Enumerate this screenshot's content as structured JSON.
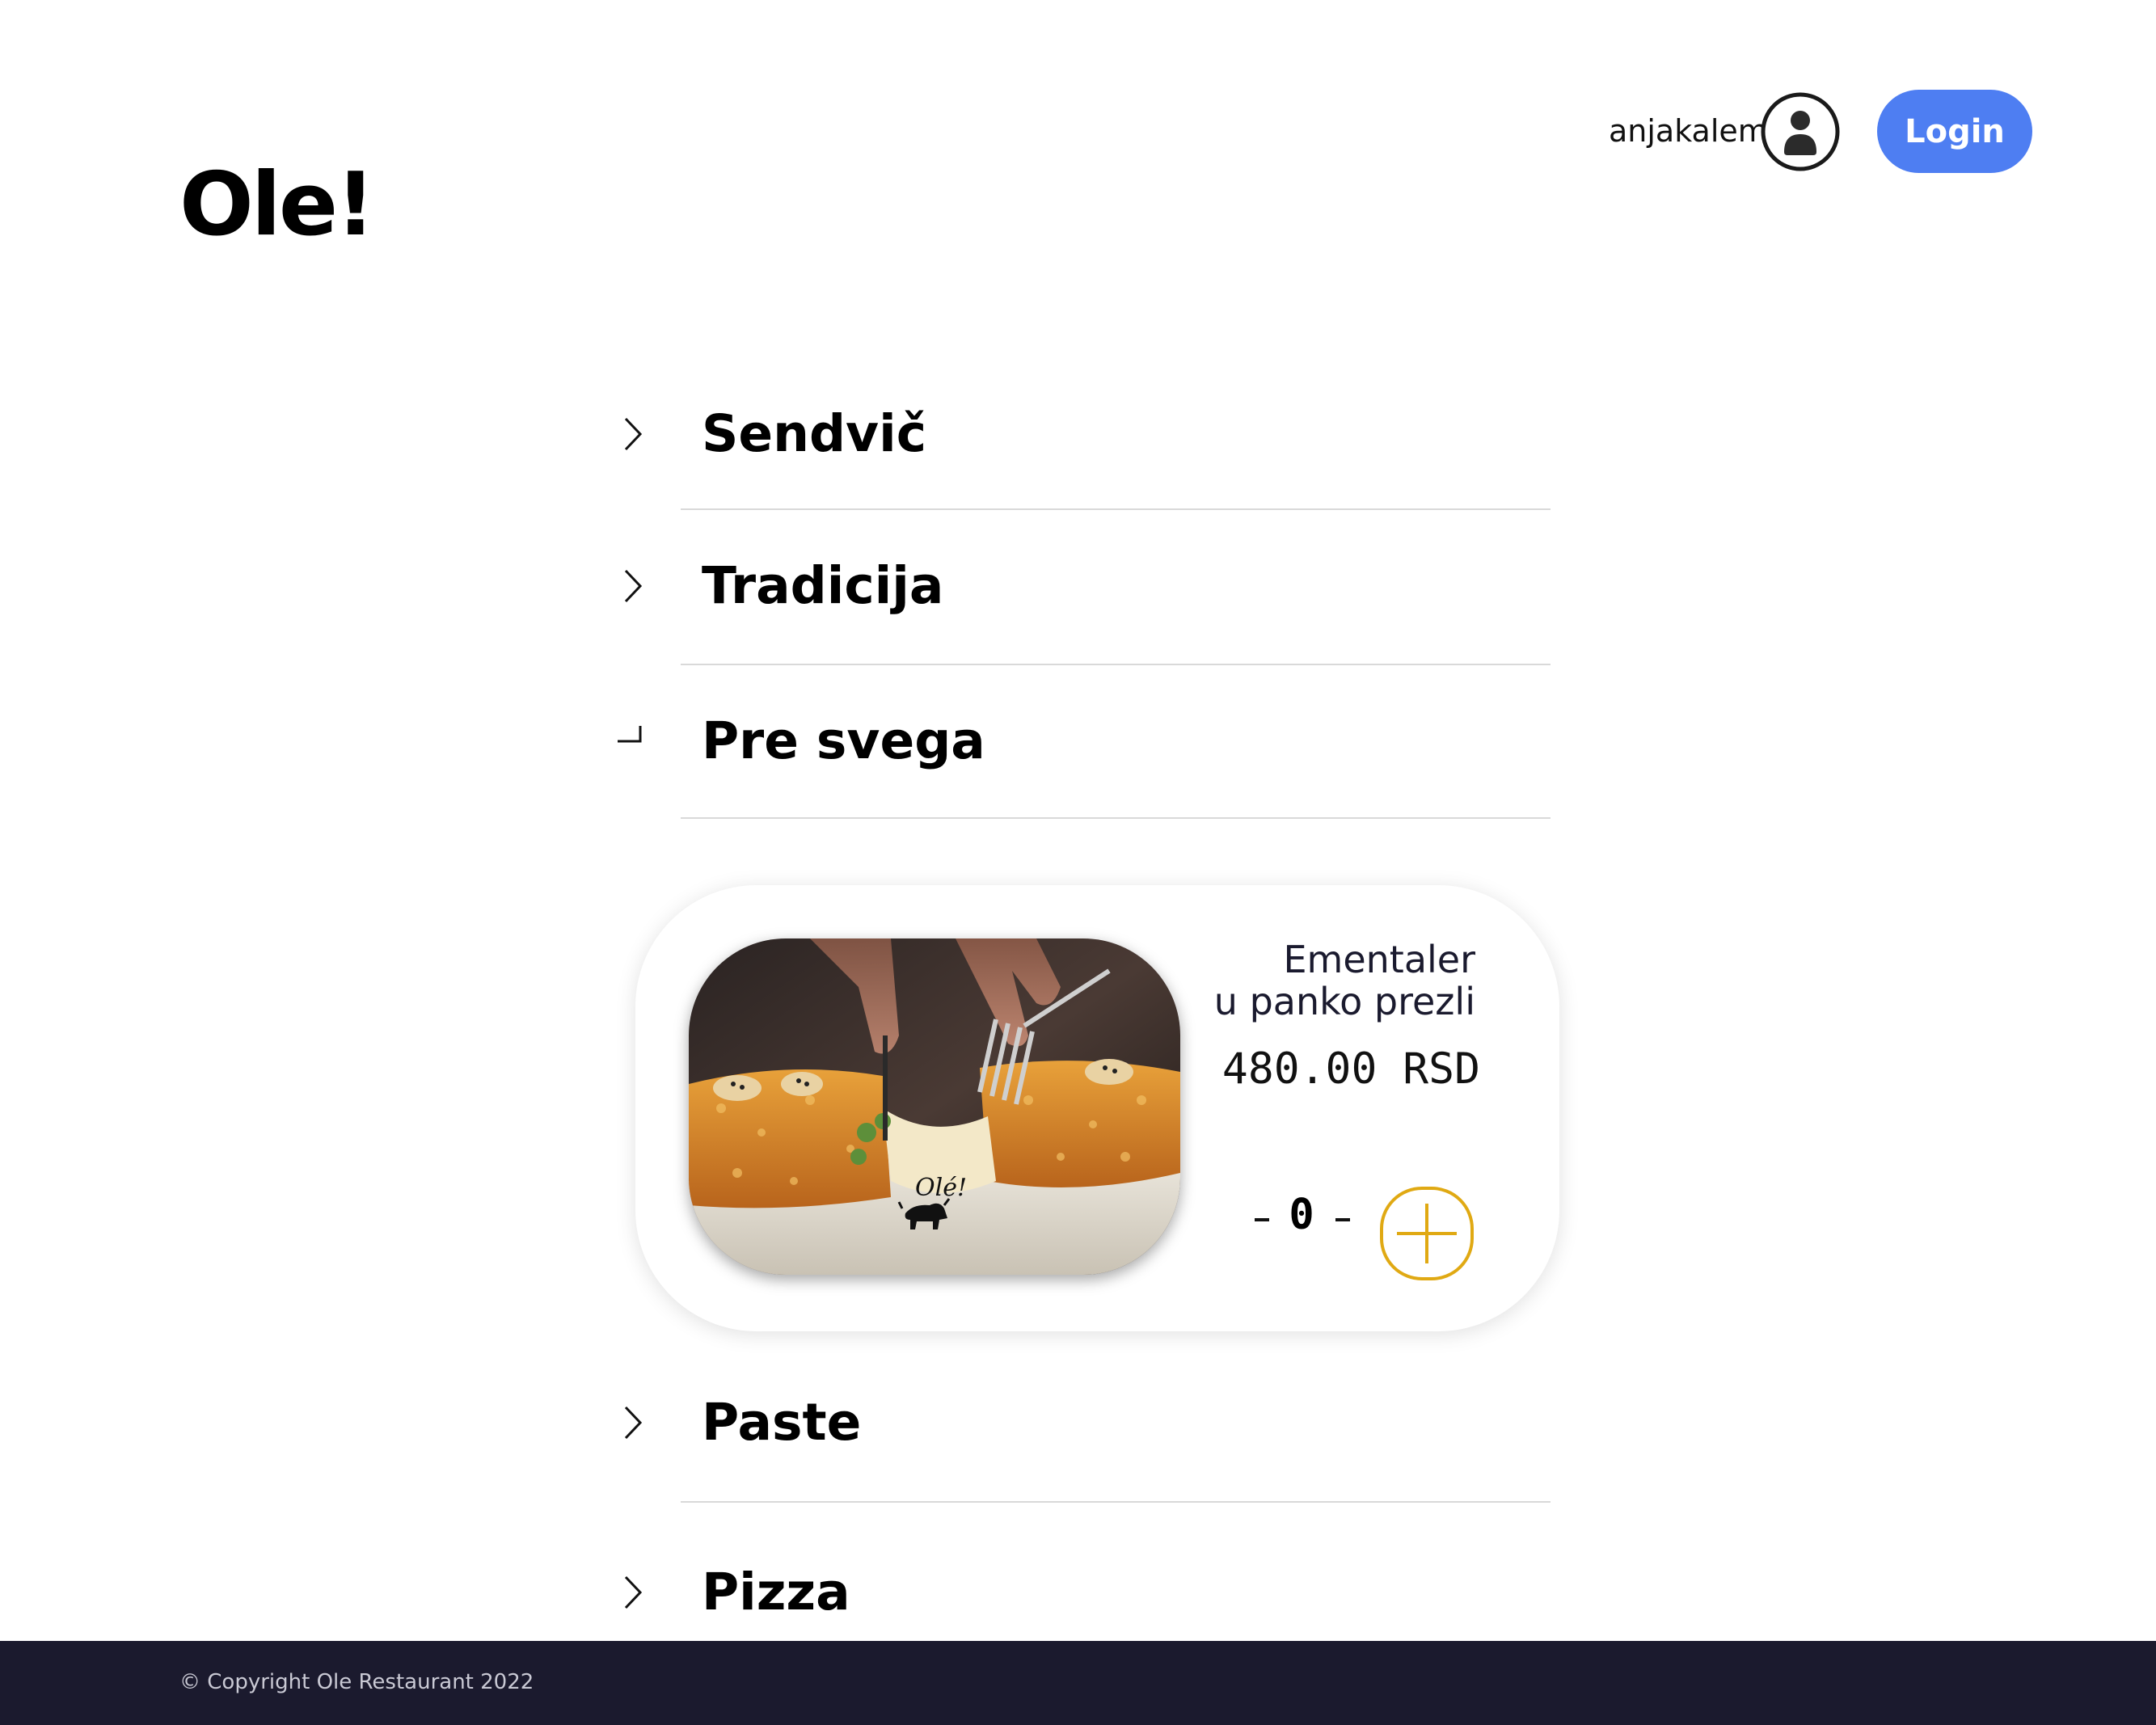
{
  "header": {
    "logo": "Ole!",
    "username": "anjakalem",
    "login_label": "Login",
    "accent_color": "#4e7ef2"
  },
  "menu": {
    "categories": [
      {
        "label": "Sendvič",
        "expanded": false,
        "icon": "chevron-right-icon"
      },
      {
        "label": "Tradicija",
        "expanded": false,
        "icon": "chevron-right-icon"
      },
      {
        "label": "Pre svega",
        "expanded": true,
        "icon": "chevron-down-icon"
      },
      {
        "label": "Paste",
        "expanded": false,
        "icon": "chevron-right-icon"
      },
      {
        "label": "Pizza",
        "expanded": false,
        "icon": "chevron-right-icon"
      }
    ],
    "item": {
      "name_line1": "Ementaler",
      "name_line2": "u panko prezli",
      "price": "480.00 RSD",
      "quantity": "0",
      "add_icon": "plus-circle-icon",
      "add_color": "#e0a913",
      "photo_logo_text": "Olé!"
    }
  },
  "footer": {
    "copyright": "© Copyright Ole Restaurant 2022",
    "background_color": "#1b1a2e"
  }
}
